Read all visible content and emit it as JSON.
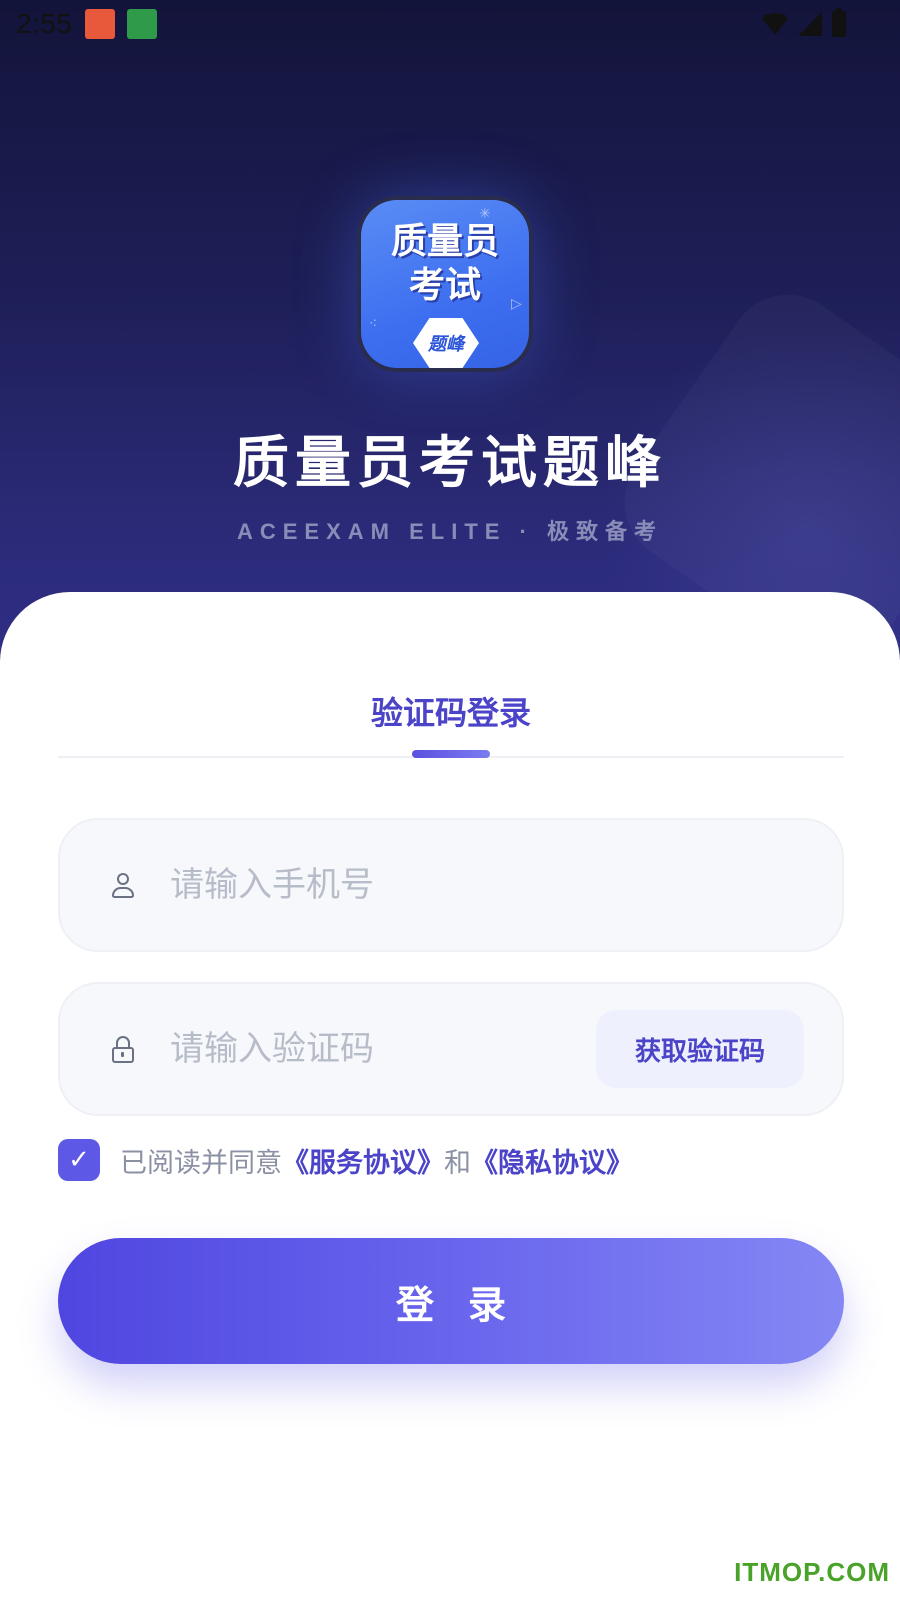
{
  "status_bar": {
    "time": "2:55",
    "notif_app1_icon": "app-notification-icon",
    "notif_app2_icon": "app-notification-icon",
    "wifi_icon": "wifi-icon",
    "signal_icon": "signal-icon",
    "battery_icon": "battery-icon"
  },
  "header": {
    "app_icon": {
      "line1": "质量员",
      "line2": "考试",
      "badge": "题峰"
    },
    "title": "质量员考试题峰",
    "subtitle": "ACEEXAM ELITE · 极致备考"
  },
  "login": {
    "tab_label": "验证码登录",
    "phone": {
      "icon": "user-icon",
      "placeholder": "请输入手机号",
      "value": ""
    },
    "code": {
      "icon": "lock-icon",
      "placeholder": "请输入验证码",
      "value": "",
      "get_code_label": "获取验证码"
    },
    "agreement": {
      "checked": true,
      "check_mark": "✓",
      "prefix": "已阅读并同意",
      "service_link": "《服务协议》",
      "conjunction": "和",
      "privacy_link": "《隐私协议》"
    },
    "submit_label": "登录"
  },
  "watermark": "ITMOP.COM",
  "colors": {
    "accent": "#4b44c8",
    "button_start": "#4f46e0",
    "button_end": "#8587f4",
    "hero_top": "#13143a",
    "hero_bottom": "#2f2e85"
  }
}
